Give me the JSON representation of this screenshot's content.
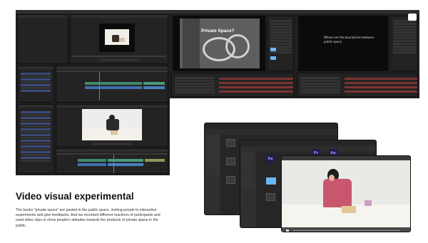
{
  "heading": "Video visual experimental",
  "description": "The books \"private space\" are pasted in the public space, inviting people to interactive experiments and give feedbacks. And we recorded different reactions of participants and used video clips to show people's attitudes towards the products of private space in the public.",
  "overlay_text_left": "Private Space?",
  "overlay_text_right_line1": "Where are the boundaries between",
  "overlay_text_right_line2": "public space",
  "colors": {
    "premiere_purple": "#9999ff",
    "after_effects_purple": "#9999ff",
    "finder_folder_blue": "#6ab7f7",
    "timeline_green": "#3e8a6a",
    "timeline_blue": "#3f6fb0",
    "keyframe_red": "#7a3434"
  },
  "icons": {
    "app_ae": "Ae",
    "app_pr": "Pr",
    "app_ae2": "Ae"
  }
}
